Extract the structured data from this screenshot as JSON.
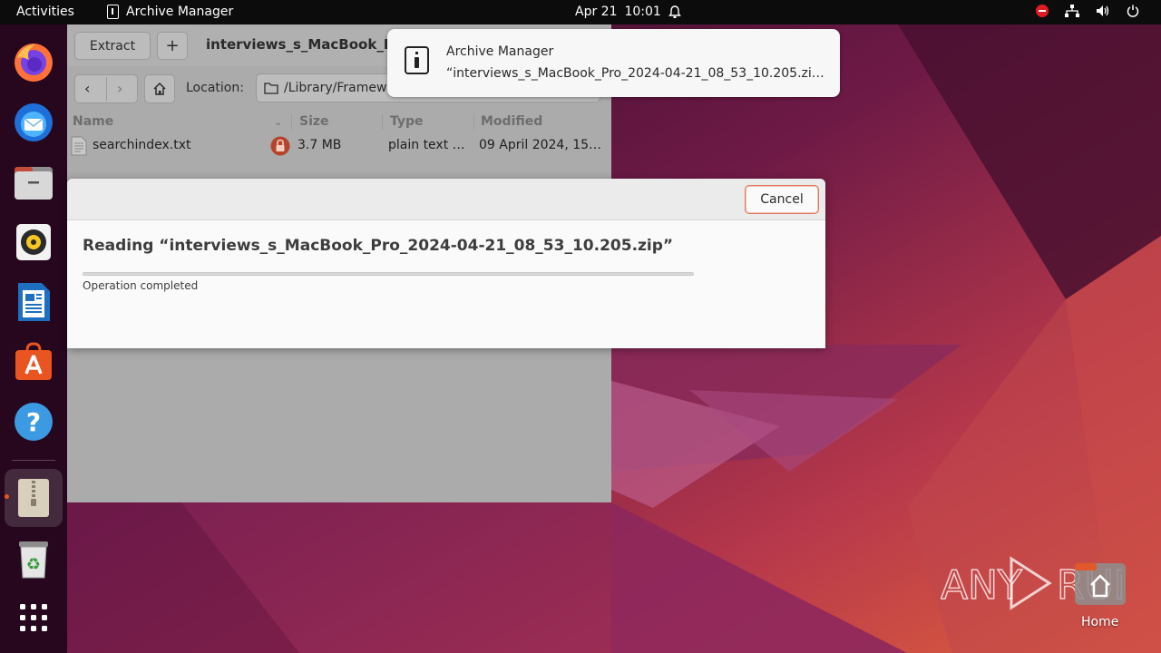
{
  "topbar": {
    "activities": "Activities",
    "app_name": "Archive Manager",
    "date": "Apr 21",
    "time": "10:01"
  },
  "dock": {
    "items": [
      {
        "name": "firefox",
        "icon": "firefox-icon"
      },
      {
        "name": "thunderbird",
        "icon": "thunderbird-icon"
      },
      {
        "name": "files",
        "icon": "files-icon"
      },
      {
        "name": "rhythmbox",
        "icon": "rhythmbox-icon"
      },
      {
        "name": "libreoffice-writer",
        "icon": "writer-icon"
      },
      {
        "name": "app-center",
        "icon": "app-center-icon"
      },
      {
        "name": "help",
        "icon": "help-icon"
      },
      {
        "name": "archive-manager",
        "icon": "archive-icon",
        "running": true
      },
      {
        "name": "trash",
        "icon": "trash-icon"
      },
      {
        "name": "show-apps",
        "icon": "grid-icon"
      }
    ]
  },
  "archive_window": {
    "extract_label": "Extract",
    "add_label": "+",
    "title": "interviews_s_MacBook_P",
    "location_label": "Location:",
    "location_value": "/Library/Framew",
    "columns": [
      "Name",
      "Size",
      "Type",
      "Modified"
    ],
    "rows": [
      {
        "name": "searchindex.txt",
        "size": "3.7 MB",
        "type": "plain text …",
        "modified": "09 April 2024, 15…"
      }
    ]
  },
  "notification": {
    "title": "Archive Manager",
    "body": "“interviews_s_MacBook_Pro_2024-04-21_08_53_10.205.zip ” i…"
  },
  "dialog": {
    "cancel_label": "Cancel",
    "title": "Reading “interviews_s_MacBook_Pro_2024-04-21_08_53_10.205.zip”",
    "status": "Operation completed",
    "progress": 1.0
  },
  "watermark": {
    "text": "ANY RUN",
    "home_label": "Home"
  }
}
